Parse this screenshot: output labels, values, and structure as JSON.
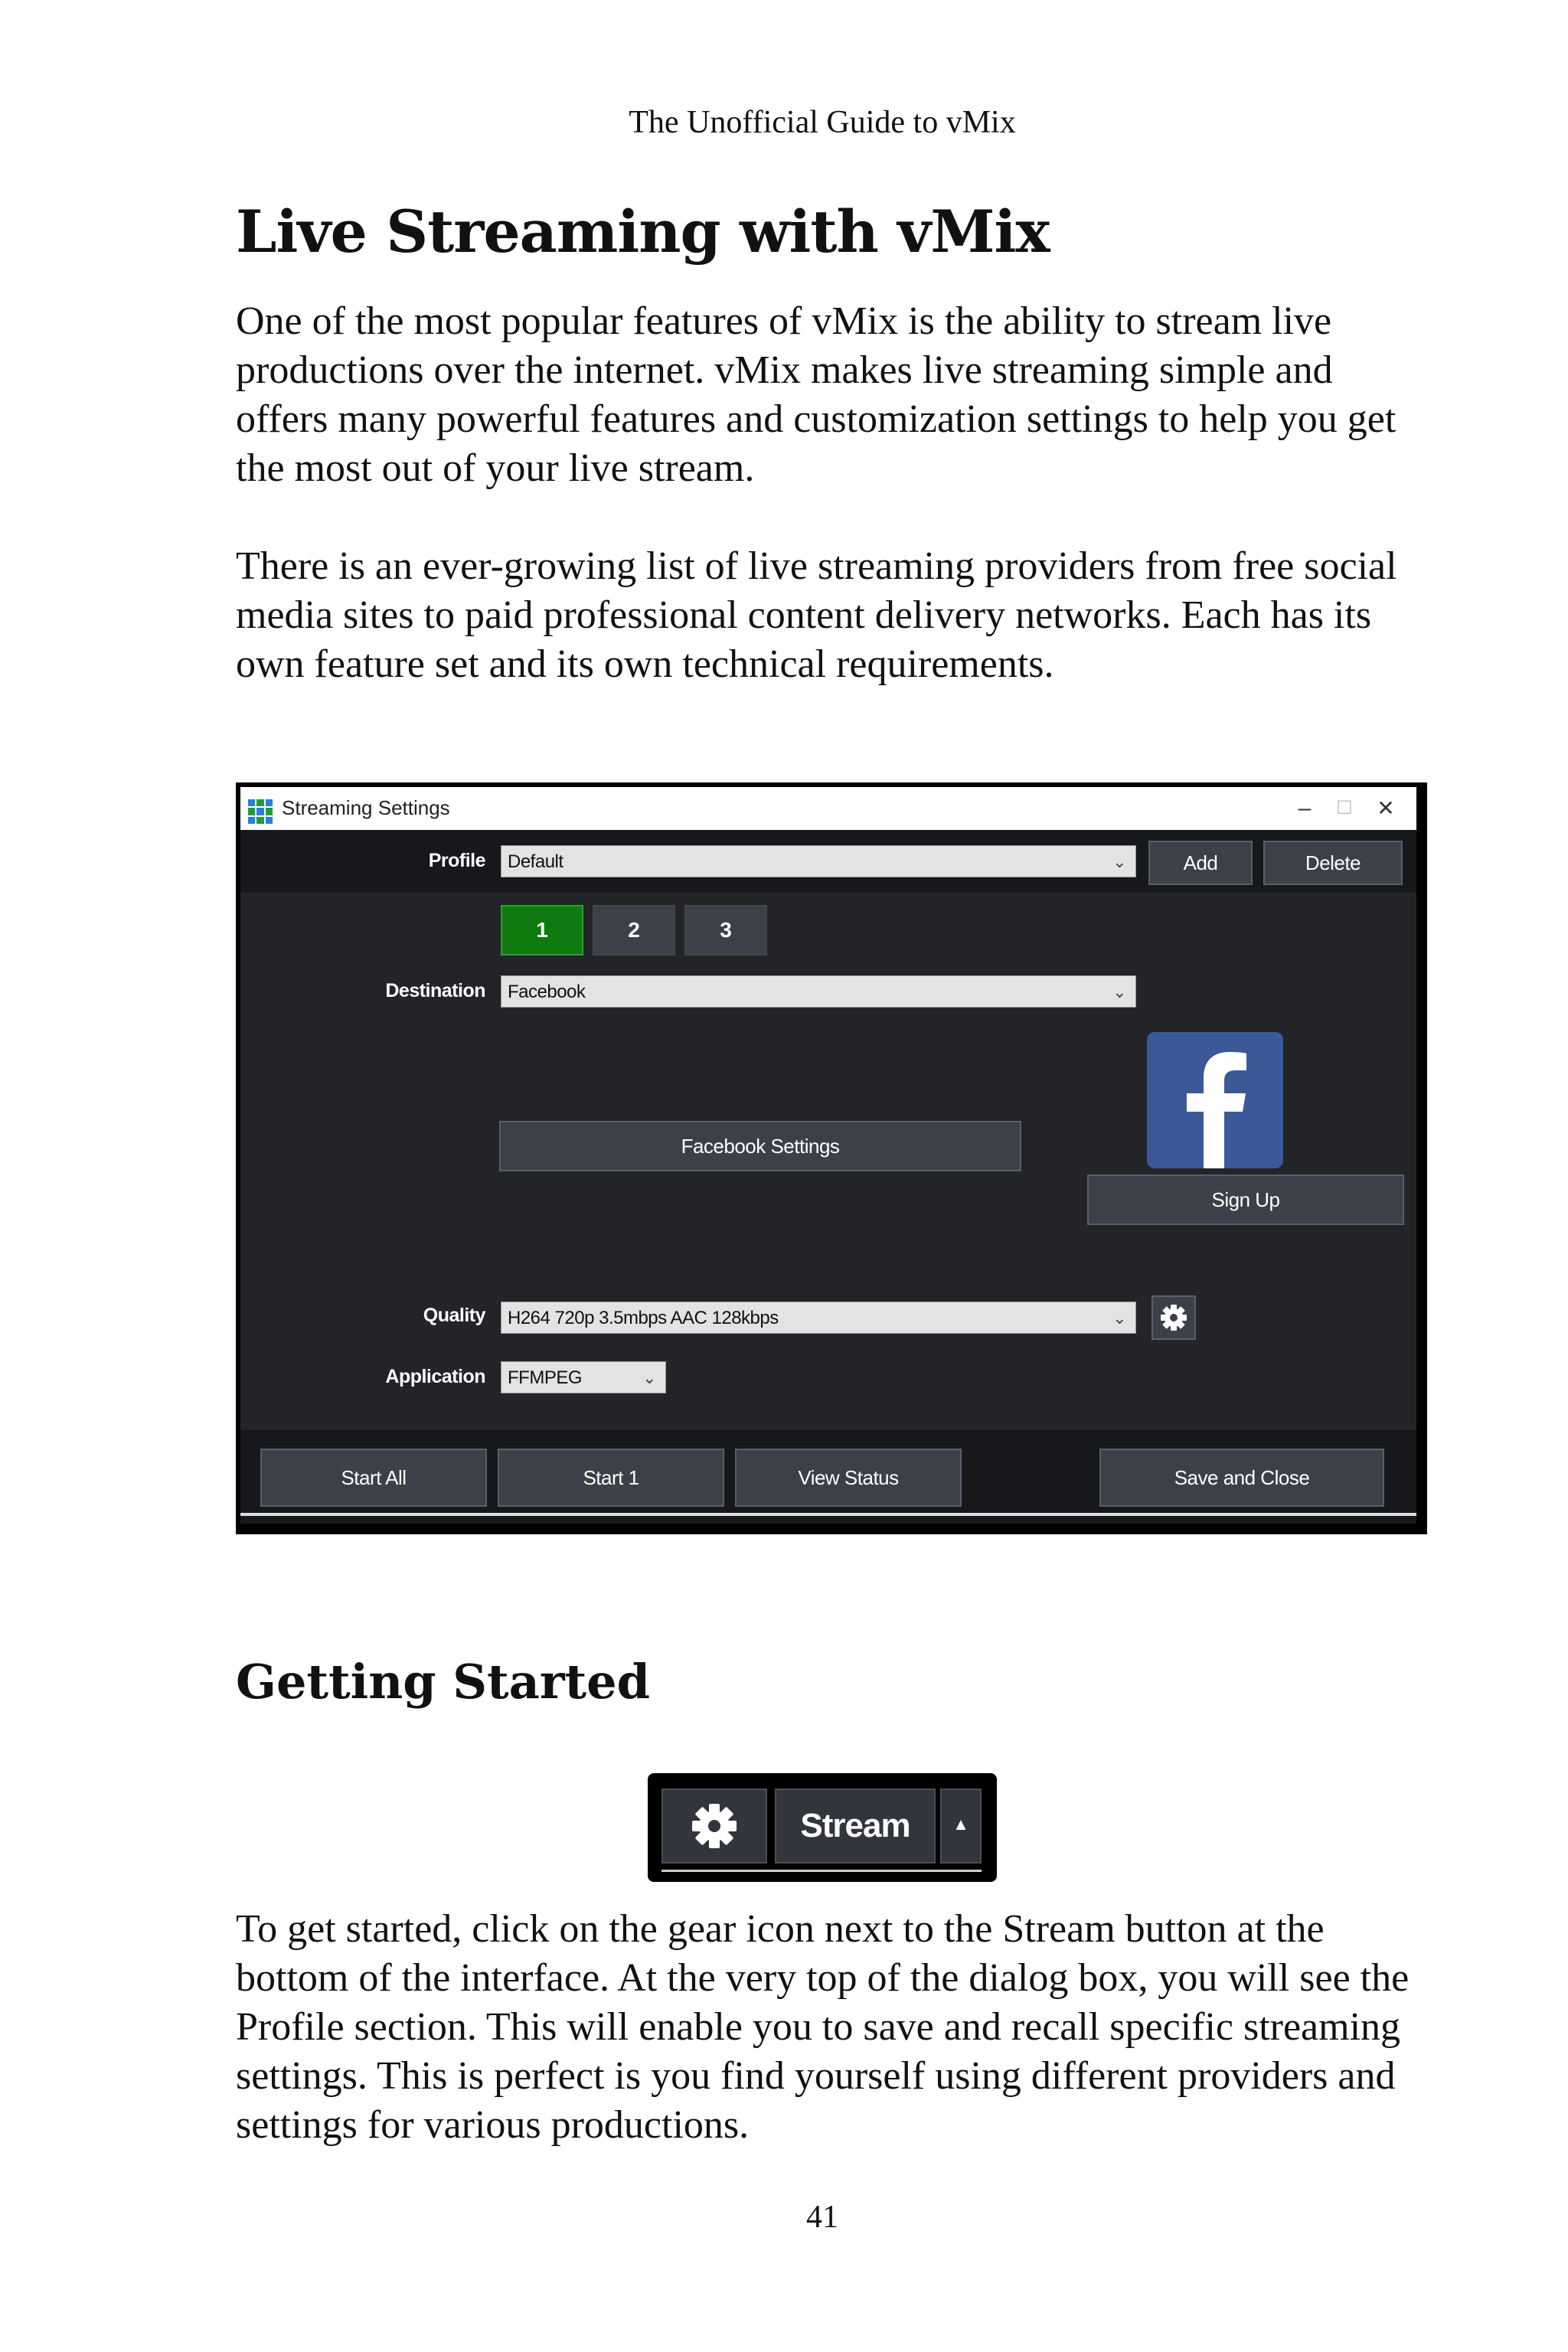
{
  "page": {
    "running_head": "The Unofficial Guide to vMix",
    "title": "Live Streaming with vMix",
    "paragraphs": [
      "One of the most popular features of vMix is the ability to stream live productions over the internet. vMix makes live streaming simple and offers many powerful features and customization settings to help you get the most out of your live stream.",
      "There is an ever-growing list of live streaming providers from free social media sites to paid professional content delivery networks. Each has its own feature set and its own technical requirements."
    ],
    "section_heading": "Getting Started",
    "closing_paragraph": "To get started, click on the gear icon next to the Stream button at the bottom of the interface. At the very top of the dialog box, you will see the Profile section. This will enable you to save and recall specific streaming settings. This is perfect is you find yourself using different providers and settings for various productions.",
    "page_number": "41"
  },
  "dialog": {
    "window_title": "Streaming Settings",
    "window_controls": {
      "minimize": "–",
      "maximize": "☐",
      "close": "✕"
    },
    "profile_label": "Profile",
    "profile_value": "Default",
    "add_label": "Add",
    "delete_label": "Delete",
    "destination_tabs": [
      {
        "label": "1",
        "selected": true
      },
      {
        "label": "2",
        "selected": false
      },
      {
        "label": "3",
        "selected": false
      }
    ],
    "destination_label": "Destination",
    "destination_value": "Facebook",
    "facebook_settings_label": "Facebook Settings",
    "facebook_logo": "f",
    "sign_up_label": "Sign Up",
    "quality_label": "Quality",
    "quality_value": "H264 720p 3.5mbps AAC 128kbps",
    "application_label": "Application",
    "application_value": "FFMPEG",
    "start_all_label": "Start All",
    "start_one_label": "Start 1",
    "view_status_label": "View Status",
    "save_close_label": "Save and Close",
    "icons": {
      "quality_settings": "gear-icon",
      "dropdown": "chevron-down-icon"
    },
    "colors": {
      "dialog_bg": "#222428",
      "strip_bg": "#17181b",
      "selected_tab": "#0f7a0f",
      "facebook_blue": "#3b5998"
    }
  },
  "stream_bar": {
    "stream_label": "Stream",
    "arrow": "▲",
    "icons": {
      "settings": "gear-icon",
      "menu": "caret-up-icon"
    }
  }
}
